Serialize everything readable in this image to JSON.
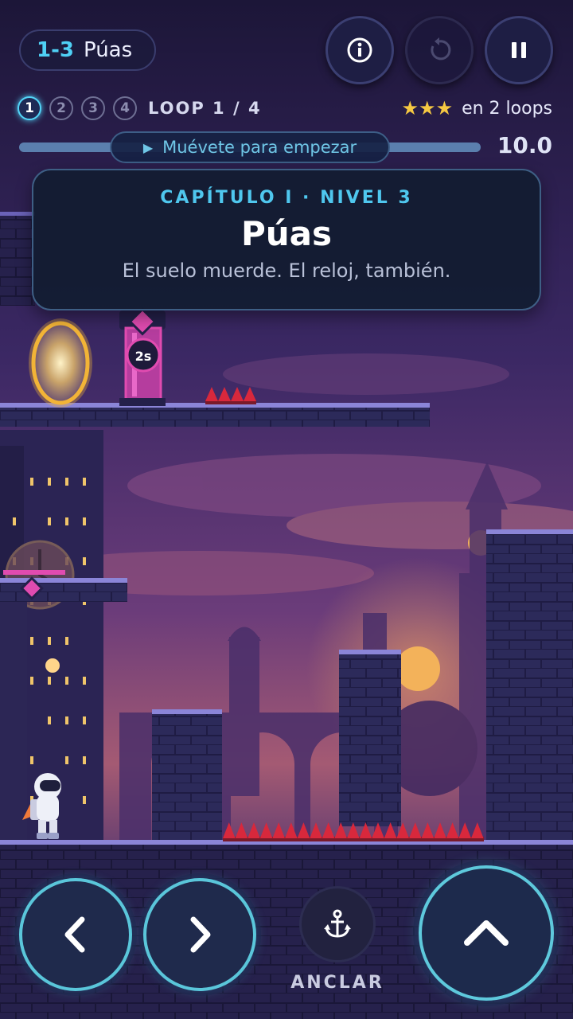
{
  "hud": {
    "level_number": "1-3",
    "level_name": "Púas",
    "loops": [
      "1",
      "2",
      "3",
      "4"
    ],
    "active_loop": 1,
    "loop_label": "LOOP 1 / 4",
    "stars_text": "★★★",
    "stars_goal": "en 2 loops",
    "start_hint": "Muévete para empezar",
    "timer": "10.0",
    "timer_fraction": 1.0
  },
  "buttons": {
    "info": "info-icon",
    "restart": "restart-icon",
    "pause": "pause-icon"
  },
  "title_card": {
    "chapter": "CAPÍTULO I · NIVEL 3",
    "title": "Púas",
    "subtitle": "El suelo muerde. El reloj, también."
  },
  "gate_timer": "2s",
  "controls": {
    "anchor_label": "ANCLAR"
  },
  "colors": {
    "accent": "#4fd0f5",
    "star": "#f5c842",
    "spike": "#d8283c",
    "portal": "#f2b437",
    "gate": "#e04bb0"
  }
}
